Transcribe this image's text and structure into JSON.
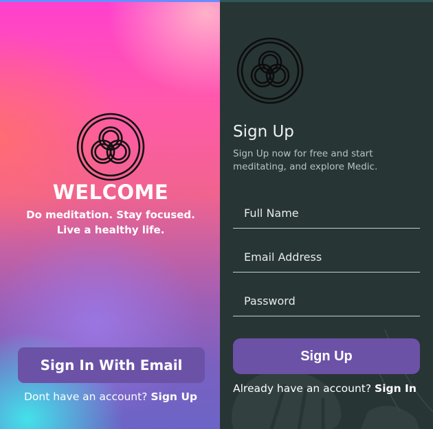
{
  "welcome_screen": {
    "heading": "WELCOME",
    "tagline_line1": "Do meditation. Stay focused.",
    "tagline_line2": "Live a healthy life.",
    "signin_button": "Sign In With Email",
    "no_account_text": "Dont have an account?",
    "signup_link": "Sign Up",
    "logo_icon": "interlocking-rings-logo"
  },
  "signup_screen": {
    "title": "Sign Up",
    "subtitle": "Sign Up now for free and start meditating, and explore Medic.",
    "fields": [
      {
        "label": "Full Name"
      },
      {
        "label": "Email Address"
      },
      {
        "label": "Password"
      }
    ],
    "signup_button": "Sign Up",
    "have_account_text": "Already have an account?",
    "signin_link": "Sign In",
    "logo_icon": "interlocking-rings-logo"
  },
  "colors": {
    "button_purple": "#6b52a7",
    "dark_panel": "#283535",
    "logo_stroke": "#101010"
  }
}
